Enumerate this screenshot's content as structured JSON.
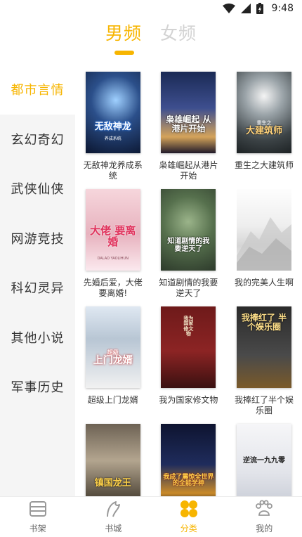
{
  "status_bar": {
    "time": "9:48"
  },
  "gender_tabs": [
    {
      "label": "男频",
      "active": true
    },
    {
      "label": "女频",
      "active": false
    }
  ],
  "categories": [
    {
      "label": "都市言情",
      "active": true
    },
    {
      "label": "玄幻奇幻"
    },
    {
      "label": "武侠仙侠"
    },
    {
      "label": "网游竞技"
    },
    {
      "label": "科幻灵异"
    },
    {
      "label": "其他小说"
    },
    {
      "label": "军事历史"
    }
  ],
  "books": [
    {
      "title": "无敌神龙养成系统",
      "cover_text": "无敌神龙",
      "cover_sub": "养成系统"
    },
    {
      "title": "枭雄崛起从港片开始",
      "cover_text": "枭雄崛起 从港片开始",
      "cover_sub": ""
    },
    {
      "title": "重生之大建筑师",
      "cover_text": "大建筑师",
      "cover_sub": "重生之"
    },
    {
      "title": "先婚后爱，大佬要离婚!",
      "cover_text": "大佬 要离婚",
      "cover_sub": "DALAO YAOLIHUN"
    },
    {
      "title": "知道剧情的我要逆天了",
      "cover_text": "知道剧情的我 要逆天了",
      "cover_sub": ""
    },
    {
      "title": "我的完美人生啊",
      "cover_text": "",
      "cover_sub": ""
    },
    {
      "title": "超级上门龙婿",
      "cover_text": "上门龙婿",
      "cover_sub": "超级"
    },
    {
      "title": "我为国家修文物",
      "cover_text": "我为国家修文物",
      "cover_sub": ""
    },
    {
      "title": "我捧红了半个娱乐圈",
      "cover_text": "我捧红了 半个娱乐圈",
      "cover_sub": ""
    },
    {
      "title": "",
      "cover_text": "镇国龙王",
      "cover_sub": ""
    },
    {
      "title": "",
      "cover_text": "我成了震惊全世界 的全能学神",
      "cover_sub": ""
    },
    {
      "title": "",
      "cover_text": "逆流一九九零",
      "cover_sub": ""
    }
  ],
  "bottom_nav": [
    {
      "label": "书架",
      "icon": "bookshelf-icon"
    },
    {
      "label": "书城",
      "icon": "bookstore-icon"
    },
    {
      "label": "分类",
      "icon": "category-icon",
      "active": true
    },
    {
      "label": "我的",
      "icon": "profile-icon"
    }
  ],
  "colors": {
    "accent": "#f7b500",
    "sidebar_bg": "#f5f5f5",
    "inactive_tab": "#d3d3d3"
  }
}
